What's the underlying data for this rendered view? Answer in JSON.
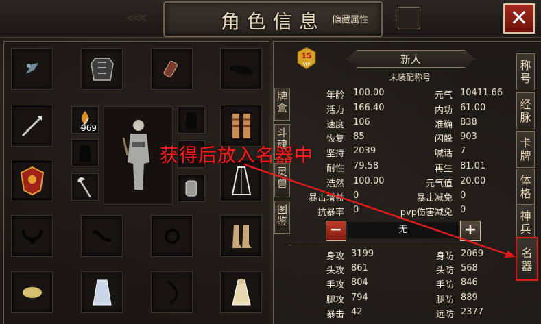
{
  "header": {
    "title": "角色信息",
    "hide_label": "隐藏属性",
    "close_label": "✕"
  },
  "equipment": {
    "count_badge": "969"
  },
  "player": {
    "name": "新人",
    "title_label": "未装配称号",
    "vip_level": "15",
    "vip_text": "VIP"
  },
  "left_tabs": [
    "牌盒",
    "斗魂",
    "灵兽",
    "图鉴"
  ],
  "side_tabs": [
    "称号",
    "经脉",
    "卡牌",
    "体格",
    "神兵",
    "名器"
  ],
  "stats_top": [
    {
      "l1": "年龄",
      "v1": "100.00",
      "l2": "元气",
      "v2": "10411.66"
    },
    {
      "l1": "活力",
      "v1": "166.40",
      "l2": "内功",
      "v2": "61.00"
    },
    {
      "l1": "速度",
      "v1": "106",
      "l2": "准确",
      "v2": "838"
    },
    {
      "l1": "恢复",
      "v1": "85",
      "l2": "闪躲",
      "v2": "903"
    },
    {
      "l1": "坚持",
      "v1": "2039",
      "l2": "喊话",
      "v2": "7"
    },
    {
      "l1": "耐性",
      "v1": "79.58",
      "l2": "再生",
      "v2": "81.01"
    },
    {
      "l1": "浩然",
      "v1": "100.00",
      "l2": "元气值",
      "v2": "20.00"
    },
    {
      "l1": "暴击增益",
      "v1": "0",
      "l2": "暴击减免",
      "v2": "0"
    },
    {
      "l1": "抗暴率",
      "v1": "0",
      "l2": "pvp伤害减免",
      "v2": "0"
    }
  ],
  "stepper": {
    "minus": "−",
    "value": "无",
    "plus": "+"
  },
  "stats_bottom": [
    {
      "l1": "身攻",
      "v1": "3199",
      "l2": "身防",
      "v2": "2069"
    },
    {
      "l1": "头攻",
      "v1": "861",
      "l2": "头防",
      "v2": "568"
    },
    {
      "l1": "手攻",
      "v1": "804",
      "l2": "手防",
      "v2": "846"
    },
    {
      "l1": "腿攻",
      "v1": "794",
      "l2": "腿防",
      "v2": "889"
    },
    {
      "l1": "暴击",
      "v1": "42",
      "l2": "远防",
      "v2": "2377"
    }
  ],
  "annotation": {
    "text": "获得后放入名器中",
    "color": "#ff1a1a"
  }
}
